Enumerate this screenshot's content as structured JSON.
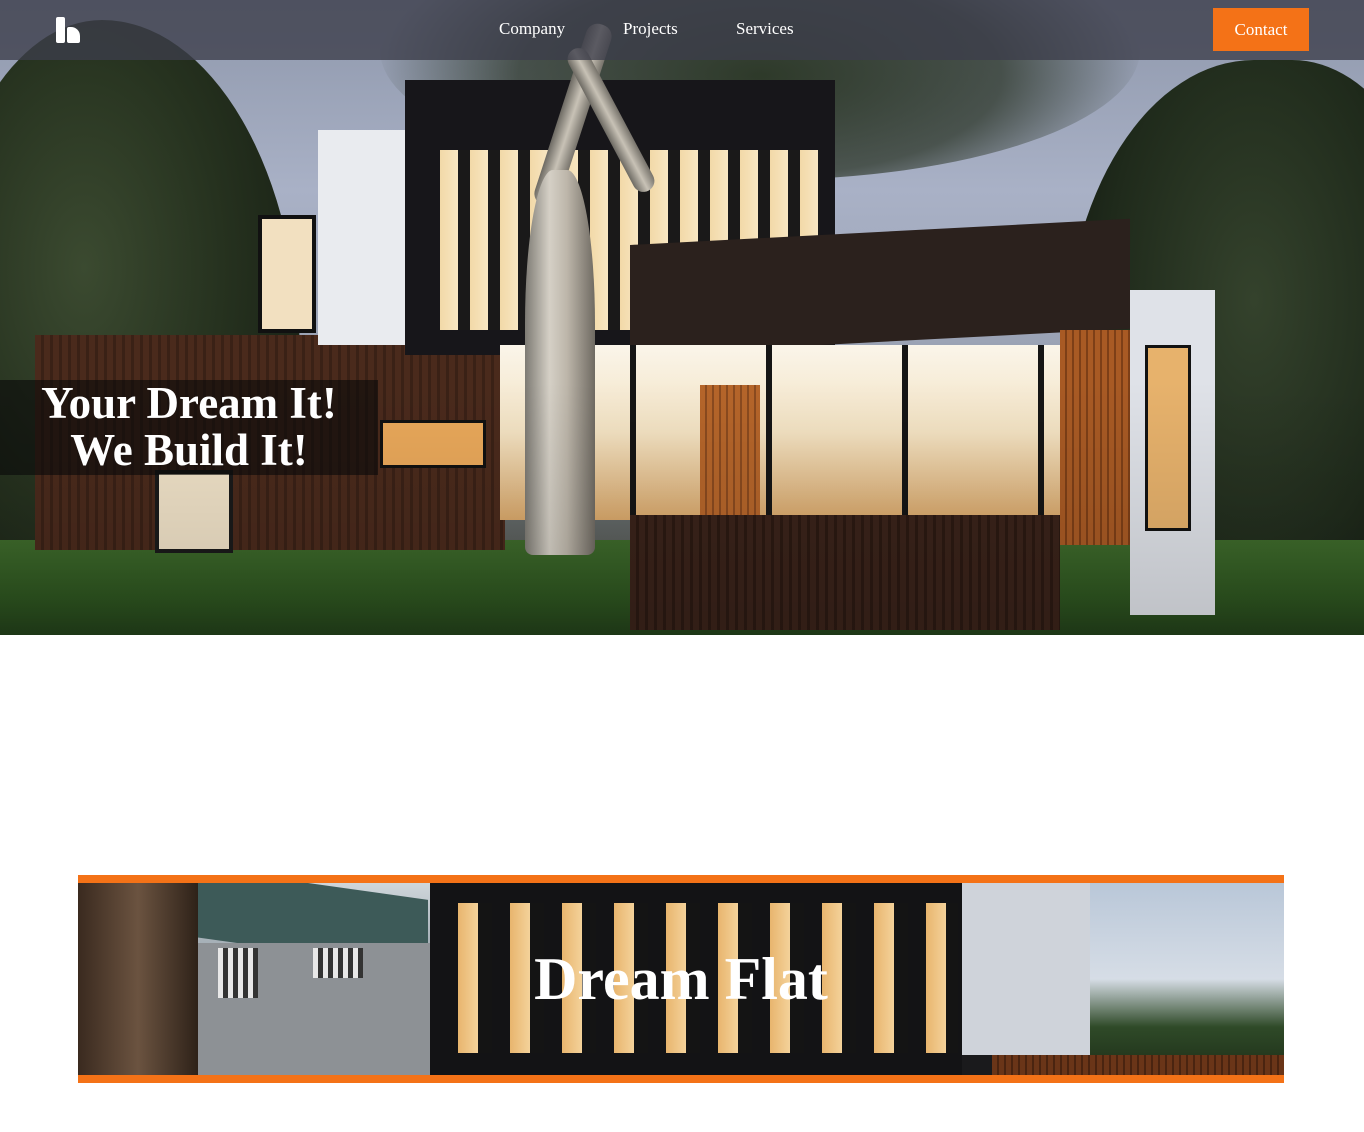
{
  "nav": {
    "logo_icon": "brand-logo-icon",
    "links": [
      {
        "label": "Company"
      },
      {
        "label": "Projects"
      },
      {
        "label": "Services"
      }
    ],
    "contact_label": "Contact",
    "accent_color": "#f47217"
  },
  "hero": {
    "headline_line1": "Your Dream It!",
    "headline_line2": "We Build It!"
  },
  "banner": {
    "title": "Dream Flat",
    "border_color": "#f47217"
  }
}
